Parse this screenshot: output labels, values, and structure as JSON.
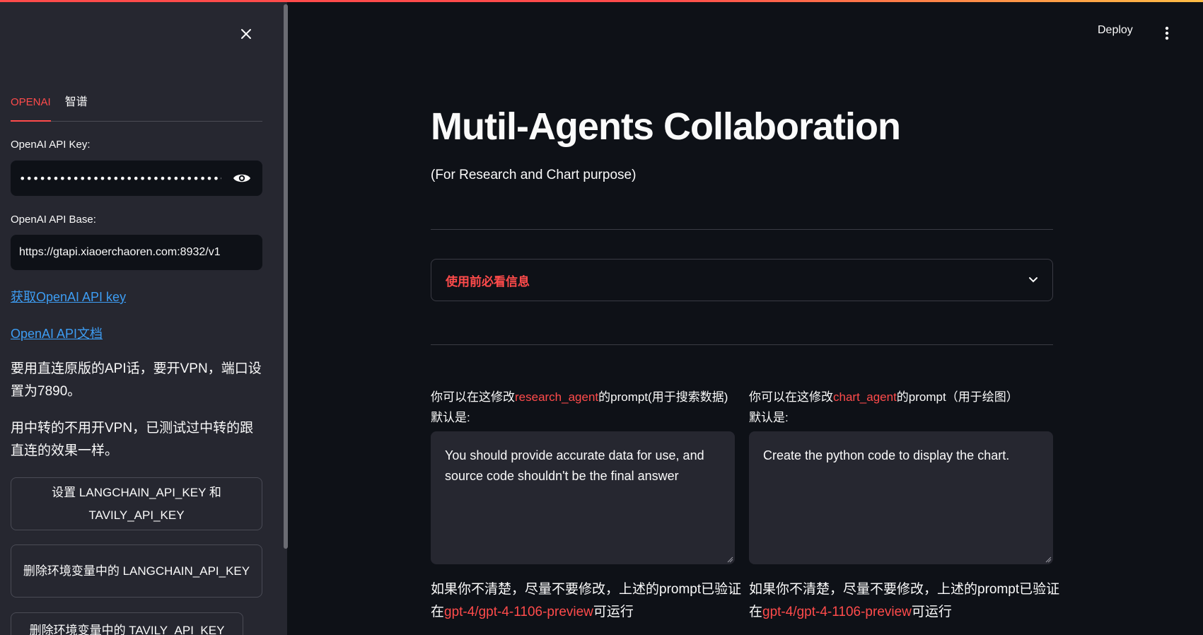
{
  "sidebar": {
    "tabs": [
      {
        "label": "OPENAI",
        "active": true
      },
      {
        "label": "智谱",
        "active": false
      }
    ],
    "api_key_label": "OpenAI API Key:",
    "api_key_value": "••••••••••••••••••••••••••••••••••••••••••••••••••••",
    "api_base_label": "OpenAI API Base:",
    "api_base_value": "https://gtapi.xiaoerchaoren.com:8932/v1",
    "link_get_key": "获取OpenAI API key",
    "link_docs": "OpenAI API文档",
    "note_vpn": "要用直连原版的API话，要开VPN，端口设置为7890。",
    "note_proxy": "用中转的不用开VPN，已测试过中转的跟直连的效果一样。",
    "btn_set_keys": "设置 LANGCHAIN_API_KEY 和 TAVILY_API_KEY",
    "btn_delete_langchain": "删除环境变量中的 LANGCHAIN_API_KEY",
    "btn_delete_tavily": "删除环境变量中的 TAVILY_API_KEY"
  },
  "header": {
    "deploy_label": "Deploy"
  },
  "main": {
    "title": "Mutil-Agents Collaboration",
    "subtitle": "(For Research and Chart purpose)",
    "expander_label": "使用前必看信息",
    "left": {
      "label_prefix": "你可以在这修改",
      "label_agent": "research_agent",
      "label_suffix": "的prompt(用于搜索数据)",
      "label_default": "默认是:",
      "prompt_value": "You should provide accurate data for use, and source code shouldn't be the final answer",
      "note_prefix": "如果你不清楚，尽量不要修改，上述的prompt已验证在",
      "note_model": "gpt-4/gpt-4-1106-preview",
      "note_suffix": "可运行"
    },
    "right": {
      "label_prefix": "你可以在这修改",
      "label_agent": "chart_agent",
      "label_suffix": "的prompt（用于绘图）",
      "label_default": "默认是:",
      "prompt_value": "Create the python code to display the chart.",
      "note_prefix": "如果你不清楚，尽量不要修改，上述的prompt已验证在",
      "note_model": "gpt-4/gpt-4-1106-preview",
      "note_suffix": "可运行"
    }
  },
  "colors": {
    "accent": "#ff4b4b",
    "link": "#3d9df3",
    "background": "#0e1117",
    "sidebar": "#262730"
  }
}
